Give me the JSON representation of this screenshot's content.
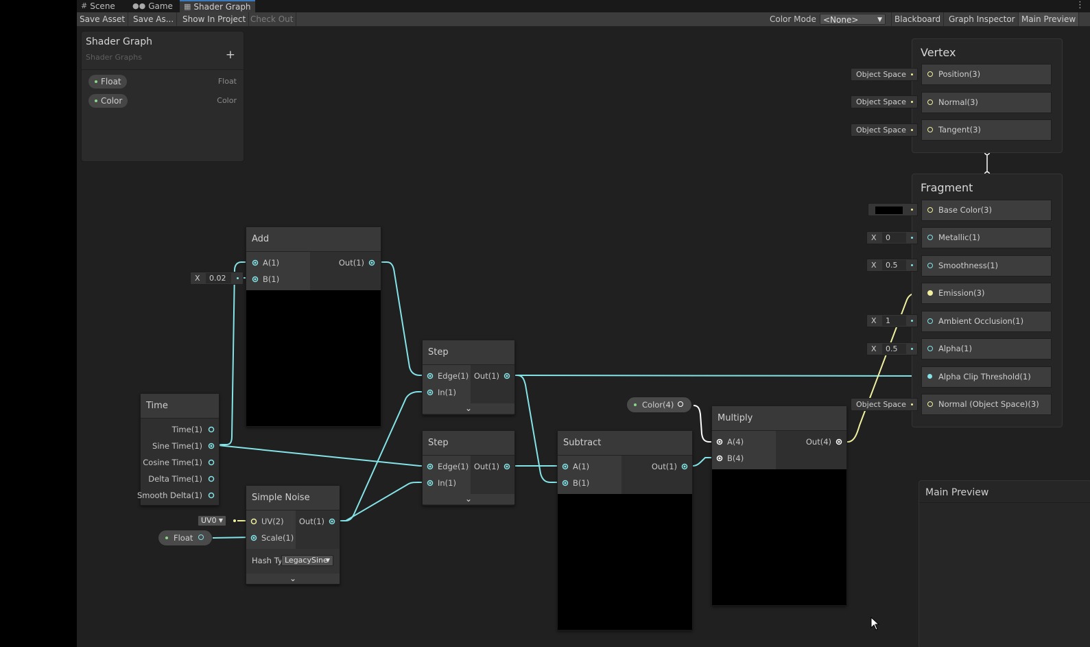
{
  "tabs": [
    {
      "label": "Scene",
      "icon": "grid-icon"
    },
    {
      "label": "Game",
      "icon": "gamepad-icon"
    },
    {
      "label": "Shader Graph",
      "icon": "shader-graph-icon"
    }
  ],
  "toolbar": {
    "save_asset": "Save Asset",
    "save_as": "Save As...",
    "show_in_project": "Show In Project",
    "check_out": "Check Out",
    "color_mode_label": "Color Mode",
    "color_mode_value": "<None>",
    "blackboard": "Blackboard",
    "graph_inspector": "Graph Inspector",
    "main_preview": "Main Preview"
  },
  "blackboard": {
    "title": "Shader Graph",
    "subtitle": "Shader Graphs",
    "add": "+",
    "properties": [
      {
        "name": "Float",
        "type": "Float"
      },
      {
        "name": "Color",
        "type": "Color"
      }
    ]
  },
  "nodes": {
    "add": {
      "title": "Add",
      "inputs": [
        "A(1)",
        "B(1)"
      ],
      "output": "Out(1)",
      "b_value": "0.02"
    },
    "step1": {
      "title": "Step",
      "inputs": [
        "Edge(1)",
        "In(1)"
      ],
      "output": "Out(1)"
    },
    "step2": {
      "title": "Step",
      "inputs": [
        "Edge(1)",
        "In(1)"
      ],
      "output": "Out(1)"
    },
    "time": {
      "title": "Time",
      "outputs": [
        "Time(1)",
        "Sine Time(1)",
        "Cosine Time(1)",
        "Delta Time(1)",
        "Smooth Delta(1)"
      ]
    },
    "noise": {
      "title": "Simple Noise",
      "inputs": [
        "UV(2)",
        "Scale(1)"
      ],
      "output": "Out(1)",
      "uv_value": "UV0",
      "hash_label": "Hash Ty",
      "hash_value": "LegacySine"
    },
    "subtract": {
      "title": "Subtract",
      "inputs": [
        "A(1)",
        "B(1)"
      ],
      "output": "Out(1)"
    },
    "multiply": {
      "title": "Multiply",
      "inputs": [
        "A(4)",
        "B(4)"
      ],
      "output": "Out(4)"
    },
    "color_prop": {
      "label": "Color(4)"
    },
    "float_prop": {
      "label": "Float"
    }
  },
  "vertex": {
    "title": "Vertex",
    "blocks": [
      {
        "label": "Position(3)",
        "space": "Object Space"
      },
      {
        "label": "Normal(3)",
        "space": "Object Space"
      },
      {
        "label": "Tangent(3)",
        "space": "Object Space"
      }
    ]
  },
  "fragment": {
    "title": "Fragment",
    "blocks": [
      {
        "label": "Base Color(3)"
      },
      {
        "label": "Metallic(1)",
        "value": "0"
      },
      {
        "label": "Smoothness(1)",
        "value": "0.5"
      },
      {
        "label": "Emission(3)"
      },
      {
        "label": "Ambient Occlusion(1)",
        "value": "1"
      },
      {
        "label": "Alpha(1)",
        "value": "0.5"
      },
      {
        "label": "Alpha Clip Threshold(1)"
      },
      {
        "label": "Normal (Object Space)(3)",
        "space": "Object Space"
      }
    ],
    "x_label": "X",
    "base_color_swatch": "#000000"
  },
  "main_preview": {
    "title": "Main Preview"
  },
  "colors": {
    "wire_float": "#84e4e7",
    "wire_vec3": "#f0f0a0",
    "wire_vec4": "#fbcbf4",
    "accent": "#3a79bb"
  }
}
